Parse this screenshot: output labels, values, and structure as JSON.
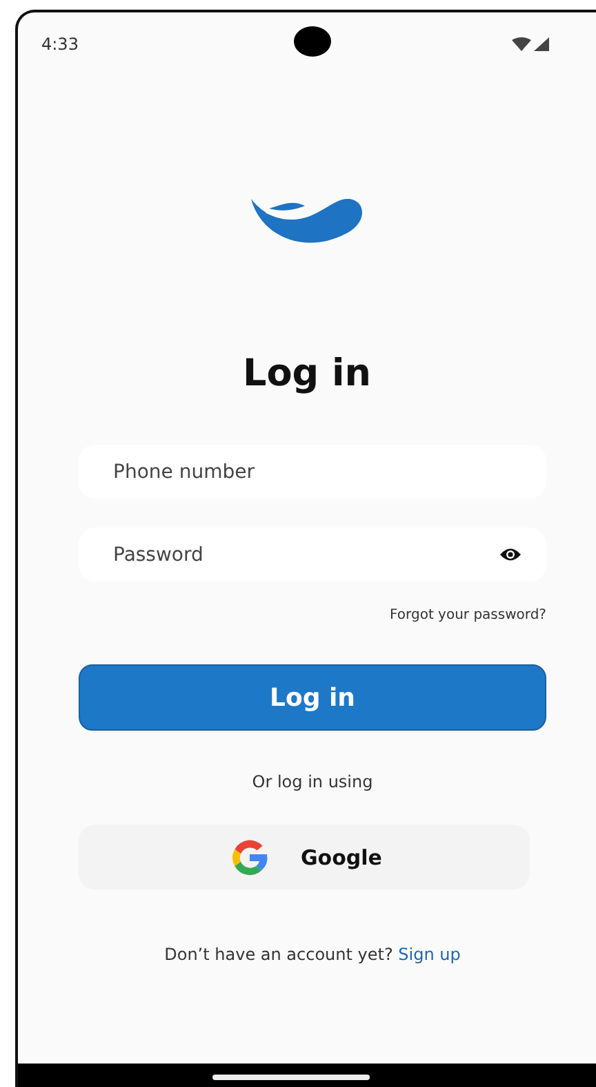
{
  "status_bar": {
    "time": "4:33"
  },
  "title": "Log in",
  "fields": [
    {
      "kind": "text",
      "placeholder": "Phone number"
    },
    {
      "kind": "password",
      "placeholder": "Password"
    }
  ],
  "forgot_link": "Forgot your password?",
  "login_button": "Log in",
  "divider_text": "Or log in using",
  "social_button": "Google",
  "signup": {
    "prompt": "Don’t have an account yet?",
    "link": "Sign up"
  }
}
